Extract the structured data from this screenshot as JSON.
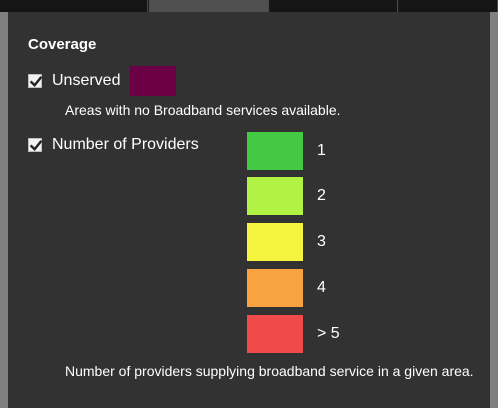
{
  "panel": {
    "title": "Coverage"
  },
  "layers": {
    "unserved": {
      "label": "Unserved",
      "checked": true,
      "color": "#6b0046",
      "description": "Areas with no Broadband services available."
    },
    "providers": {
      "label": "Number of Providers",
      "checked": true,
      "legend": [
        {
          "label": "1",
          "color": "#44c944"
        },
        {
          "label": "2",
          "color": "#b1f244"
        },
        {
          "label": "3",
          "color": "#f5f540"
        },
        {
          "label": "4",
          "color": "#f8a240"
        },
        {
          "label": "> 5",
          "color": "#f04a4a"
        }
      ],
      "description": "Number of providers supplying broadband service in a given area."
    }
  }
}
